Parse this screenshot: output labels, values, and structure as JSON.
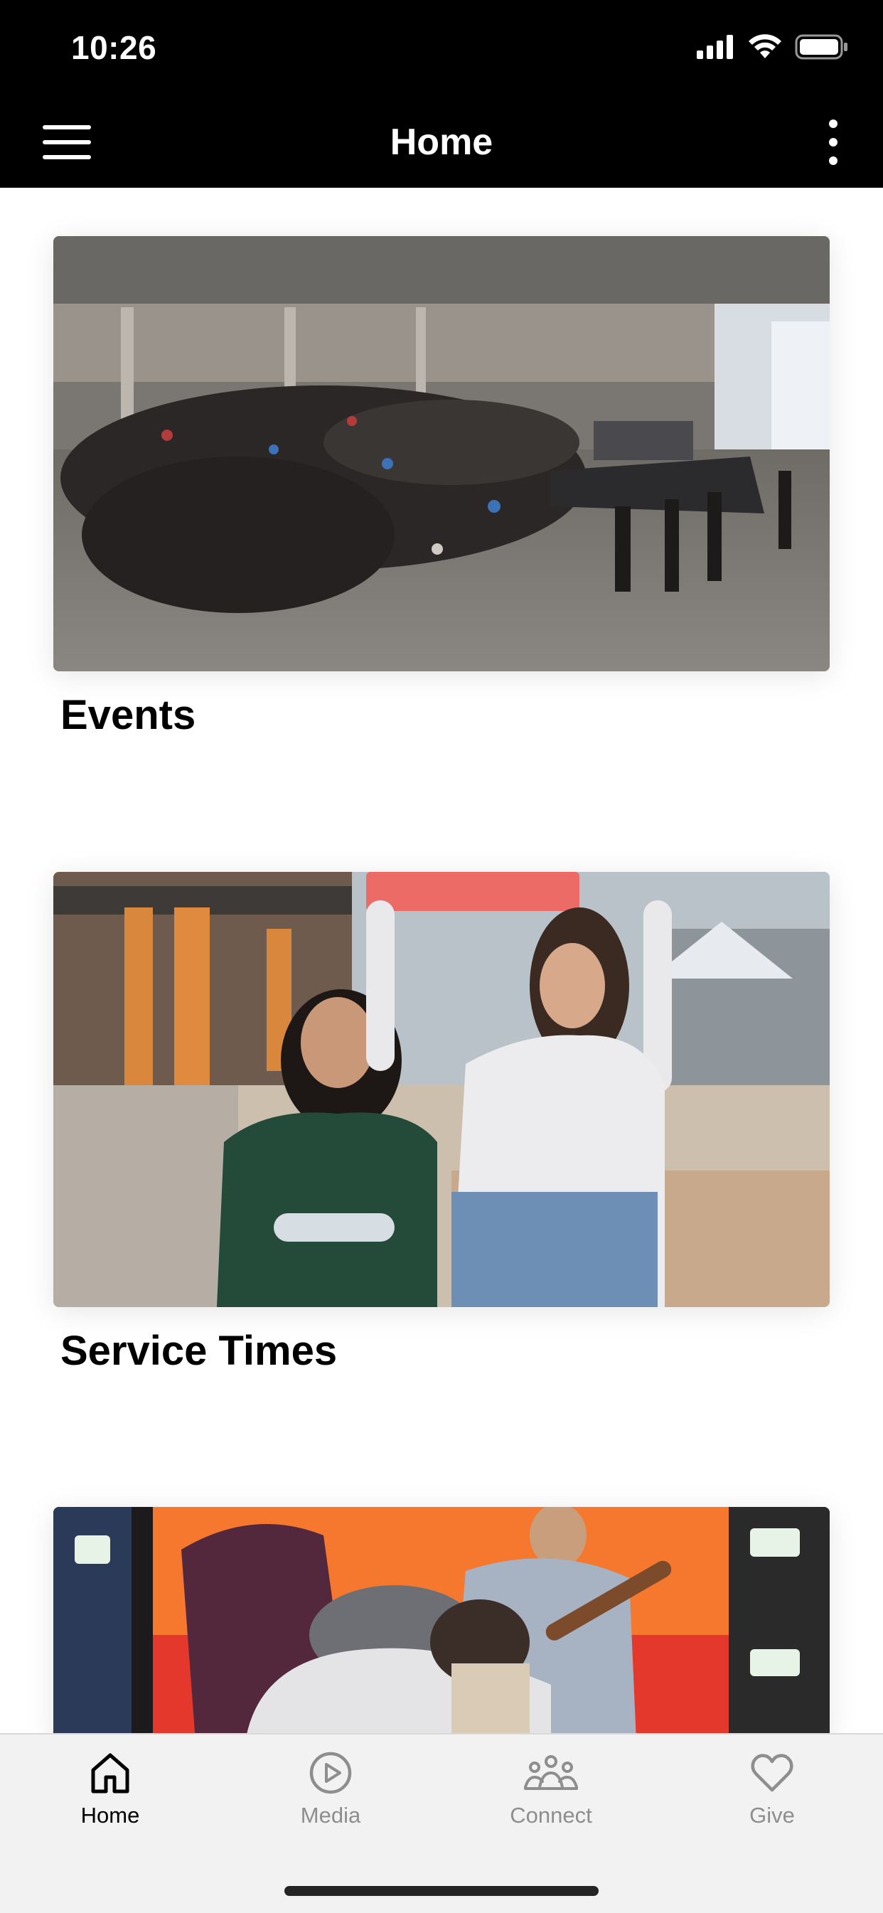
{
  "status_bar": {
    "time": "10:26"
  },
  "nav": {
    "title": "Home"
  },
  "cards": [
    {
      "title": "Events",
      "image": "crowd-in-warehouse-photo"
    },
    {
      "title": "Service Times",
      "image": "two-women-smiling-photo"
    },
    {
      "title": "",
      "image": "people-hugging-worship-photo"
    }
  ],
  "tabs": [
    {
      "label": "Home",
      "icon": "home-icon",
      "active": true
    },
    {
      "label": "Media",
      "icon": "play-circle-icon",
      "active": false
    },
    {
      "label": "Connect",
      "icon": "group-icon",
      "active": false
    },
    {
      "label": "Give",
      "icon": "heart-icon",
      "active": false
    }
  ],
  "colors": {
    "active_tab": "#000000",
    "inactive_tab": "#8e8e8e",
    "header_bg": "#000000"
  }
}
